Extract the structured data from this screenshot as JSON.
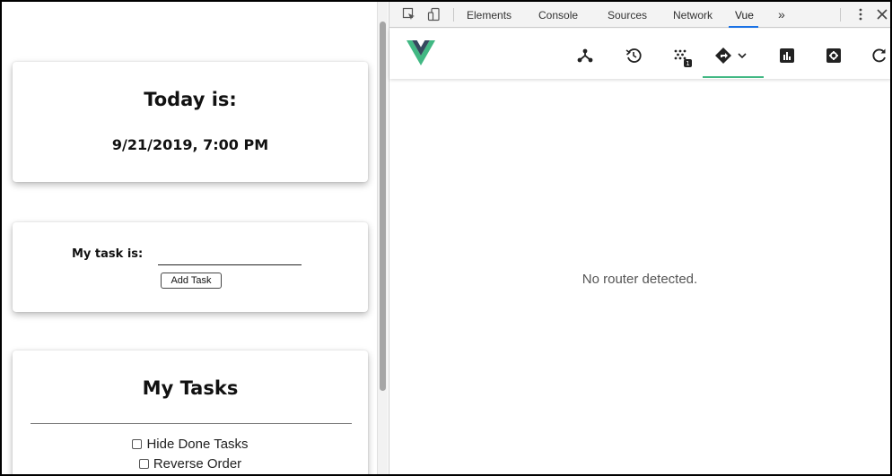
{
  "app": {
    "today_title": "Today is:",
    "today_date": "9/21/2019, 7:00 PM",
    "task_label": "My task is:",
    "task_input_value": "",
    "add_button": "Add Task",
    "tasks_title": "My Tasks",
    "options": [
      {
        "label": "Hide Done Tasks",
        "checked": false
      },
      {
        "label": "Reverse Order",
        "checked": false
      }
    ]
  },
  "devtools": {
    "tabs": [
      "Elements",
      "Console",
      "Sources",
      "Network",
      "Vue"
    ],
    "active_tab": "Vue",
    "more_tabs": "»",
    "vue_tools": [
      {
        "icon": "components-icon",
        "active": false
      },
      {
        "icon": "timeline-icon",
        "active": false
      },
      {
        "icon": "vuex-icon",
        "badge": "1",
        "active": false
      },
      {
        "icon": "router-icon",
        "active": true
      },
      {
        "icon": "performance-icon",
        "active": false
      },
      {
        "icon": "settings-icon",
        "active": false
      },
      {
        "icon": "refresh-icon",
        "active": false
      }
    ],
    "empty_message": "No router detected."
  },
  "colors": {
    "vue_green": "#41b883",
    "vue_dark": "#35495e",
    "tab_accent": "#1a73e8"
  }
}
